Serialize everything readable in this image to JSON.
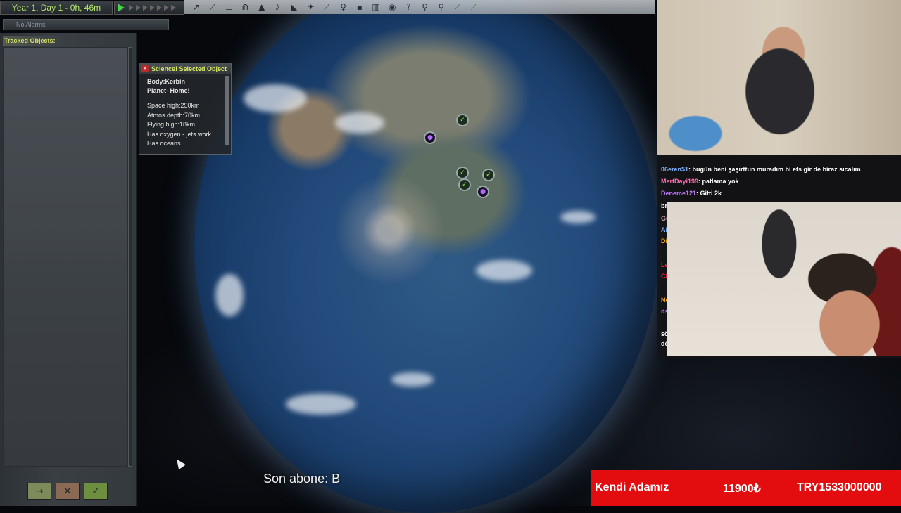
{
  "game_clock": {
    "date_time": "Year 1, Day 1 - 0h, 46m"
  },
  "alarm_clock": {
    "status": "No Alarms"
  },
  "toolbar": {
    "icons": [
      "maneuver-icon",
      "rocket-icon",
      "rover-icon",
      "lander-icon",
      "probe-icon",
      "satellite-icon",
      "plane-icon",
      "base-icon",
      "science-icon",
      "station-icon",
      "flag-icon",
      "help-icon",
      "contracts-icon",
      "waypoint-icon",
      "ground-icon",
      "antenna-icon",
      "rocket-launch-icon",
      "map-icon"
    ]
  },
  "tracking": {
    "title": "Tracked Objects:"
  },
  "science_window": {
    "title": "Science! Selected Object",
    "body": "Body:Kerbin",
    "planet": "Planet- Home!",
    "details": [
      "Space high:250km",
      "Atmos depth:70km",
      "Flying high:18km",
      "Has oxygen - jets work",
      "Has oceans"
    ]
  },
  "chat": {
    "messages": [
      {
        "user": "06eren51",
        "text": ": bugün beni şaşırttun muradım bi ets gir de biraz sıcalım",
        "color": "#7fb3ff"
      },
      {
        "user": "MertDayi199",
        "text": ": patlama yok",
        "color": "#ff6fb1"
      },
      {
        "user": "Deneme121",
        "text": ": Gitti 2k",
        "color": "#c479ff"
      }
    ],
    "partial": [
      "br",
      "Gu",
      "Al",
      "Di",
      "Le",
      "Cl",
      "Ne",
      "ds",
      "sö",
      "dö"
    ]
  },
  "overlay": {
    "last_subscriber": "Son abone: B",
    "donation_name": "Kendi Adamız",
    "donation_amount": "11900₺",
    "donation_goal": "TRY1533000000"
  },
  "colors": {
    "accent_green": "#b6e86d",
    "label_yellow": "#d8e46a",
    "donation_red": "#e30d0f"
  }
}
